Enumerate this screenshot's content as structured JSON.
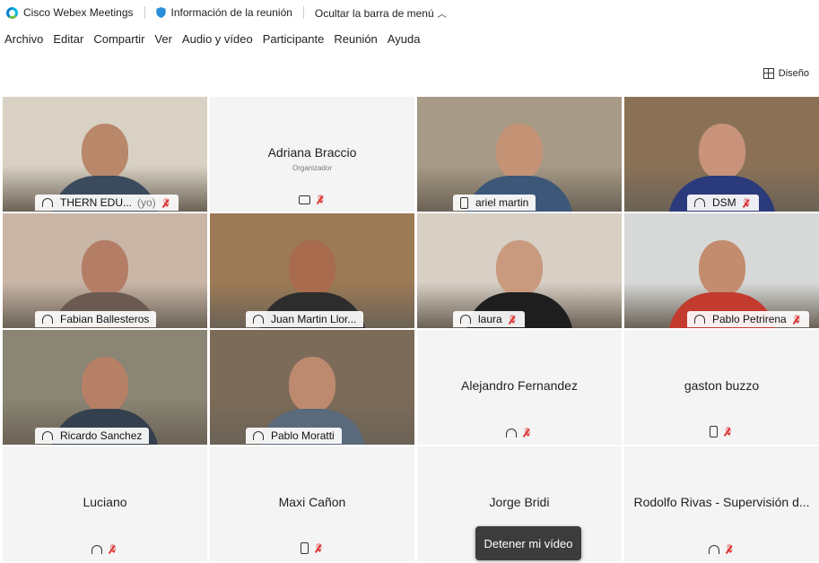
{
  "titlebar": {
    "app_name": "Cisco Webex Meetings",
    "meeting_info": "Información de la reunión",
    "hide_menu": "Ocultar la barra de menú"
  },
  "menu": [
    "Archivo",
    "Editar",
    "Compartir",
    "Ver",
    "Audio y vídeo",
    "Participante",
    "Reunión",
    "Ayuda"
  ],
  "layout_button": "Diseño",
  "participants": [
    {
      "name": "THERN EDU...",
      "suffix": "(yo)",
      "video": true,
      "icon": "headset-icon",
      "muted": true,
      "bg": "#d9d2c4",
      "shirt": "#3b4a5c",
      "skin": "#b9876a"
    },
    {
      "name": "Adriana Braccio",
      "sub": "Organizador",
      "video": false,
      "icon": "video-device-icon",
      "muted": true
    },
    {
      "name": "ariel martin",
      "video": true,
      "icon": "phone-icon",
      "muted": false,
      "bg": "#a79a86",
      "shirt": "#3d5778",
      "skin": "#c49376"
    },
    {
      "name": "DSM",
      "video": true,
      "icon": "headset-icon",
      "muted": true,
      "bg": "#8a7156",
      "shirt": "#2a3a7a",
      "skin": "#c8937a"
    },
    {
      "name": "Fabian Ballesteros",
      "video": true,
      "icon": "headset-icon",
      "muted": false,
      "bg": "#c9b6a7",
      "shirt": "#6b5a52",
      "skin": "#b47e66"
    },
    {
      "name": "Juan Martin Llor...",
      "video": true,
      "icon": "headset-icon",
      "muted": false,
      "bg": "#9c7a55",
      "shirt": "#2d2d2d",
      "skin": "#a86b4e"
    },
    {
      "name": "laura",
      "video": true,
      "icon": "headset-icon",
      "muted": true,
      "bg": "#d8cfc5",
      "shirt": "#1e1e1e",
      "skin": "#c99a7e"
    },
    {
      "name": "Pablo Petrirena",
      "video": true,
      "icon": "headset-icon",
      "muted": true,
      "bg": "#d7d9d8",
      "shirt": "#c23b2e",
      "skin": "#c38c6e"
    },
    {
      "name": "Ricardo Sanchez",
      "video": true,
      "icon": "headset-icon",
      "muted": false,
      "bg": "#8a8574",
      "shirt": "#35404e",
      "skin": "#b68066"
    },
    {
      "name": "Pablo Moratti",
      "video": true,
      "icon": "headset-icon",
      "muted": false,
      "bg": "#7c6b58",
      "shirt": "#5a6a7a",
      "skin": "#bd8a70"
    },
    {
      "name": "Alejandro Fernandez",
      "video": false,
      "icon": "headset-icon",
      "muted": true
    },
    {
      "name": "gaston buzzo",
      "video": false,
      "icon": "phone-icon",
      "muted": true
    },
    {
      "name": "Luciano",
      "video": false,
      "icon": "headset-icon",
      "muted": true
    },
    {
      "name": "Maxi Cañon",
      "video": false,
      "icon": "phone-icon",
      "muted": true
    },
    {
      "name": "Jorge Bridi",
      "video": false,
      "icon": "",
      "muted": false
    },
    {
      "name": "Rodolfo Rivas - Supervisión d...",
      "video": false,
      "icon": "headset-icon",
      "muted": true
    }
  ],
  "stop_video_button": "Detener mi vídeo"
}
